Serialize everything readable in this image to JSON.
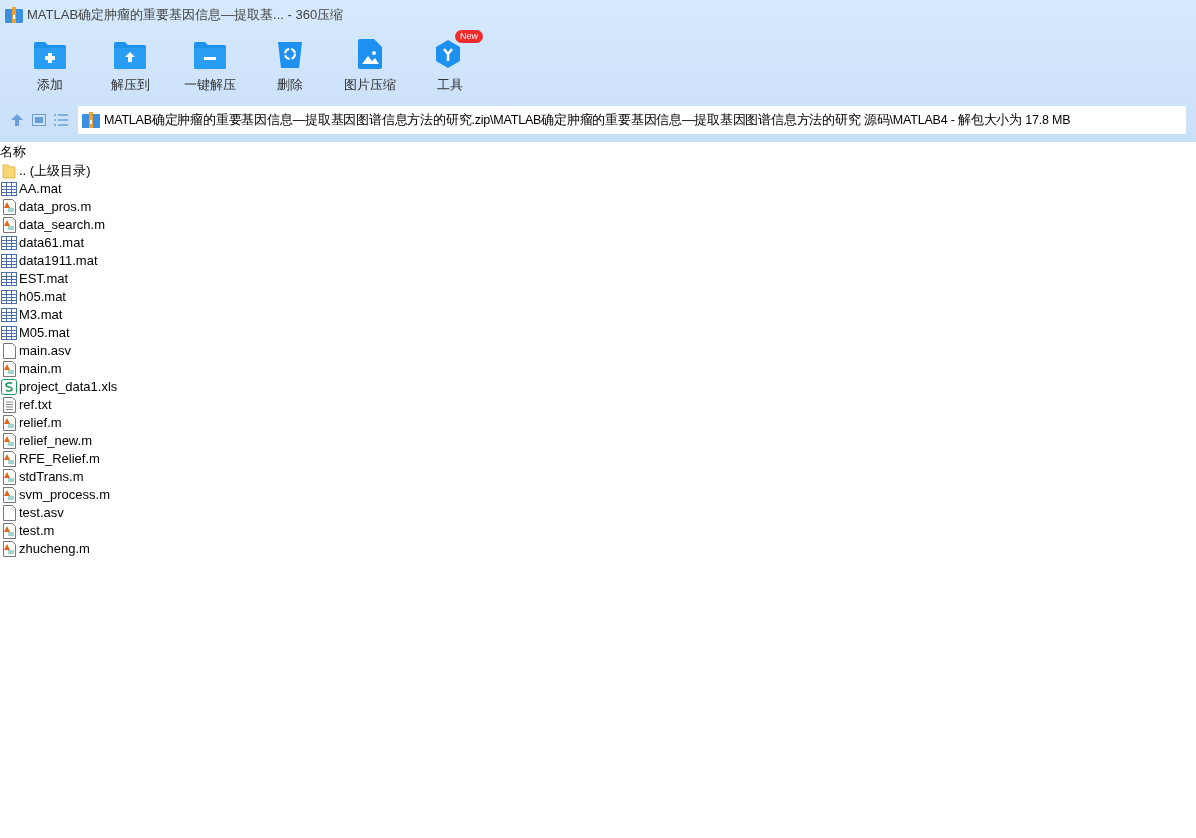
{
  "window": {
    "title": "MATLAB确定肿瘤的重要基因信息—提取基... - 360压缩"
  },
  "toolbar": [
    {
      "label": "添加",
      "kind": "add"
    },
    {
      "label": "解压到",
      "kind": "extract"
    },
    {
      "label": "一键解压",
      "kind": "oneclick"
    },
    {
      "label": "删除",
      "kind": "delete"
    },
    {
      "label": "图片压缩",
      "kind": "image"
    },
    {
      "label": "工具",
      "kind": "tools",
      "badge": "New"
    }
  ],
  "address": {
    "path": "MATLAB确定肿瘤的重要基因信息—提取基因图谱信息方法的研究.zip\\MATLAB确定肿瘤的重要基因信息—提取基因图谱信息方法的研究 源码\\MATLAB4 - 解包大小为 17.8 MB"
  },
  "list": {
    "columns": [
      "名称"
    ],
    "rows": [
      {
        "name": ".. (上级目录)",
        "kind": "folder"
      },
      {
        "name": "AA.mat",
        "kind": "mat"
      },
      {
        "name": "data_pros.m",
        "kind": "m"
      },
      {
        "name": "data_search.m",
        "kind": "m"
      },
      {
        "name": "data61.mat",
        "kind": "mat"
      },
      {
        "name": "data1911.mat",
        "kind": "mat"
      },
      {
        "name": "EST.mat",
        "kind": "mat"
      },
      {
        "name": "h05.mat",
        "kind": "mat"
      },
      {
        "name": "M3.mat",
        "kind": "mat"
      },
      {
        "name": "M05.mat",
        "kind": "mat"
      },
      {
        "name": "main.asv",
        "kind": "blank"
      },
      {
        "name": "main.m",
        "kind": "m"
      },
      {
        "name": "project_data1.xls",
        "kind": "xls"
      },
      {
        "name": "ref.txt",
        "kind": "txt"
      },
      {
        "name": "relief.m",
        "kind": "m"
      },
      {
        "name": "relief_new.m",
        "kind": "m"
      },
      {
        "name": "RFE_Relief.m",
        "kind": "m"
      },
      {
        "name": "stdTrans.m",
        "kind": "m"
      },
      {
        "name": "svm_process.m",
        "kind": "m"
      },
      {
        "name": "test.asv",
        "kind": "blank"
      },
      {
        "name": "test.m",
        "kind": "m"
      },
      {
        "name": "zhucheng.m",
        "kind": "m"
      }
    ]
  }
}
